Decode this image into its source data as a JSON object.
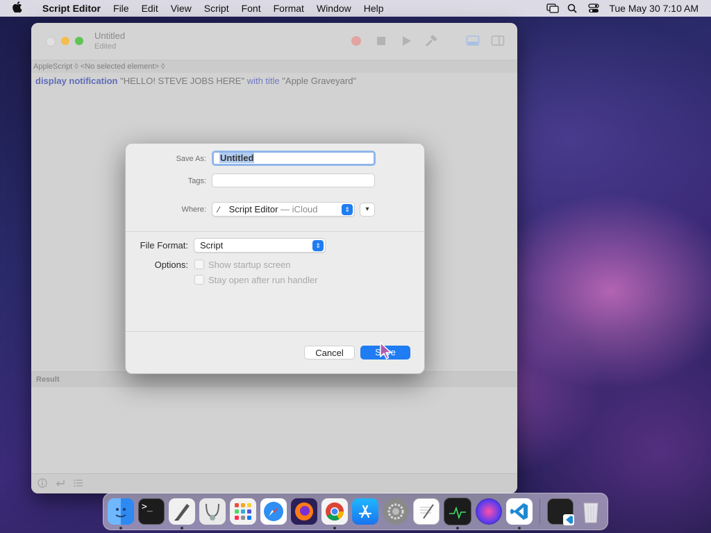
{
  "menubar": {
    "app_name": "Script Editor",
    "items": [
      "File",
      "Edit",
      "View",
      "Script",
      "Font",
      "Format",
      "Window",
      "Help"
    ],
    "clock": "Tue May 30  7:10 AM"
  },
  "window": {
    "title": "Untitled",
    "subtitle": "Edited",
    "nav_language": "AppleScript ◊",
    "nav_element": "<No selected element> ◊",
    "code": {
      "kw1": "display notification",
      "str1": " \"HELLO! STEVE JOBS HERE\" ",
      "kw2": "with title",
      "str2": " \"Apple Graveyard\""
    },
    "result_label": "Result"
  },
  "dialog": {
    "save_as_label": "Save As:",
    "save_as_value": "Untitled",
    "tags_label": "Tags:",
    "tags_value": "",
    "where_label": "Where:",
    "where_value": "Script Editor",
    "where_suffix": " — iCloud",
    "file_format_label": "File Format:",
    "file_format_value": "Script",
    "options_label": "Options:",
    "option_1": "Show startup screen",
    "option_2": "Stay open after run handler",
    "cancel_label": "Cancel",
    "save_label": "Save"
  },
  "dock": {
    "apps": [
      "finder-icon",
      "terminal-icon",
      "script-editor-icon",
      "disk-utility-icon",
      "launchpad-icon",
      "safari-icon",
      "firefox-icon",
      "chrome-icon",
      "app-store-icon",
      "system-preferences-icon",
      "textedit-icon",
      "activity-monitor-icon",
      "siri-icon",
      "vscode-icon",
      "terminal-window-icon",
      "trash-icon"
    ]
  },
  "colors": {
    "accent": "#1f7cf2",
    "keyword": "#5e6cb8"
  }
}
